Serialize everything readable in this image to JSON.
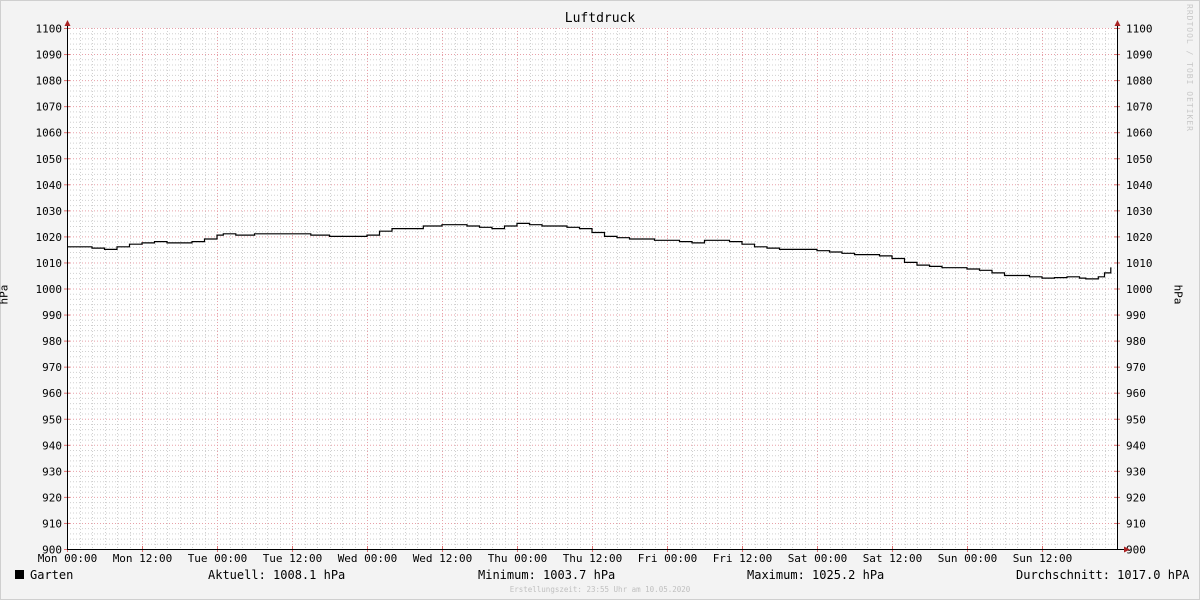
{
  "chart_data": {
    "type": "line",
    "title": "Luftdruck",
    "ylabel_left": "hPa",
    "ylabel_right": "hPa",
    "ylim": [
      900,
      1100
    ],
    "y_ticks": [
      900,
      910,
      920,
      930,
      940,
      950,
      960,
      970,
      980,
      990,
      1000,
      1010,
      1020,
      1030,
      1040,
      1050,
      1060,
      1070,
      1080,
      1090,
      1100
    ],
    "x_range_hours": [
      0,
      168
    ],
    "x_ticks": [
      {
        "hour": 0,
        "label": "Mon 00:00"
      },
      {
        "hour": 12,
        "label": "Mon 12:00"
      },
      {
        "hour": 24,
        "label": "Tue 00:00"
      },
      {
        "hour": 36,
        "label": "Tue 12:00"
      },
      {
        "hour": 48,
        "label": "Wed 00:00"
      },
      {
        "hour": 60,
        "label": "Wed 12:00"
      },
      {
        "hour": 72,
        "label": "Thu 00:00"
      },
      {
        "hour": 84,
        "label": "Thu 12:00"
      },
      {
        "hour": 96,
        "label": "Fri 00:00"
      },
      {
        "hour": 108,
        "label": "Fri 12:00"
      },
      {
        "hour": 120,
        "label": "Sat 00:00"
      },
      {
        "hour": 132,
        "label": "Sat 12:00"
      },
      {
        "hour": 144,
        "label": "Sun 00:00"
      },
      {
        "hour": 156,
        "label": "Sun 12:00"
      }
    ],
    "grid": true,
    "colors": {
      "line": "#000000",
      "grid_major": "#e8a0a8",
      "grid_minor": "#d0d0d0",
      "axis": "#000000",
      "arrow": "#aa2222"
    },
    "series": [
      {
        "name": "Garten",
        "x": [
          0,
          2,
          4,
          6,
          8,
          10,
          12,
          14,
          16,
          18,
          20,
          22,
          24,
          25,
          27,
          30,
          33,
          36,
          39,
          42,
          45,
          48,
          50,
          52,
          54,
          57,
          60,
          62,
          64,
          66,
          68,
          70,
          72,
          74,
          76,
          78,
          80,
          82,
          84,
          86,
          88,
          90,
          92,
          94,
          96,
          98,
          100,
          102,
          104,
          106,
          108,
          110,
          112,
          114,
          116,
          118,
          120,
          122,
          124,
          126,
          128,
          130,
          132,
          134,
          136,
          138,
          140,
          142,
          144,
          146,
          148,
          150,
          152,
          154,
          156,
          158,
          160,
          162,
          163,
          164,
          165,
          166,
          167
        ],
        "values": [
          1016,
          1016,
          1015.5,
          1015,
          1016,
          1017,
          1017.5,
          1018,
          1017.5,
          1017.5,
          1018,
          1019,
          1020.5,
          1021,
          1020.5,
          1021,
          1021,
          1021,
          1020.5,
          1020,
          1020,
          1020.5,
          1022,
          1023,
          1023,
          1024,
          1024.5,
          1024.5,
          1024,
          1023.5,
          1023,
          1024,
          1025,
          1024.5,
          1024,
          1024,
          1023.5,
          1023,
          1021.5,
          1020,
          1019.5,
          1019,
          1019,
          1018.5,
          1018.5,
          1018,
          1017.5,
          1018.5,
          1018.5,
          1018,
          1017,
          1016,
          1015.5,
          1015,
          1015,
          1015,
          1014.5,
          1014,
          1013.5,
          1013,
          1013,
          1012.5,
          1011.5,
          1010,
          1009,
          1008.5,
          1008,
          1008,
          1007.5,
          1007,
          1006,
          1005,
          1005,
          1004.5,
          1004,
          1004.2,
          1004.5,
          1004,
          1003.7,
          1003.7,
          1004.5,
          1006,
          1008.1
        ]
      }
    ]
  },
  "watermark": "RRDTOOL / TOBI OETIKER",
  "legend": {
    "series_name": "Garten",
    "current": "Aktuell: 1008.1 hPa",
    "minimum": "Minimum: 1003.7 hPa",
    "maximum": "Maximum: 1025.2 hPa",
    "average": "Durchschnitt: 1017.0 hPA"
  },
  "footer": "Erstellungszeit: 23:55 Uhr am 10.05.2020"
}
